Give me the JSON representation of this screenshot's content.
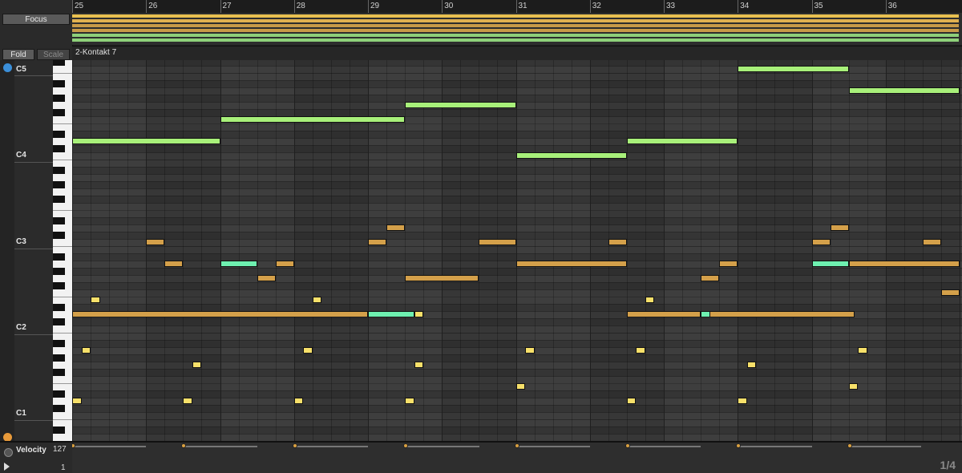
{
  "header": {
    "focus_label": "Focus",
    "fold_label": "Fold",
    "scale_label": "Scale",
    "clip_name": "2-Kontakt 7"
  },
  "ruler": {
    "bars": [
      "25",
      "26",
      "27",
      "28",
      "29",
      "30",
      "31",
      "32",
      "33",
      "34",
      "35",
      "36"
    ]
  },
  "piano": {
    "octave_labels": [
      "C5",
      "C4",
      "C3",
      "C2",
      "C1"
    ]
  },
  "velocity": {
    "label": "Velocity",
    "max_label": "127",
    "min_label": "1"
  },
  "footer": {
    "page_indicator": "1/4"
  },
  "colors": {
    "lead_note": "#a8f07a",
    "mid_note": "#d4a04a",
    "low_note": "#f7e06a",
    "highlight_note": "#6ef0b0",
    "accent_blue": "#3b8fd9",
    "accent_orange": "#e89a3a"
  },
  "icons": {
    "top_round": "arrow-up-circle-icon",
    "bottom_round": "arrow-down-circle-icon",
    "velocity_small": "velocity-toggle-icon",
    "velocity_play": "play-icon"
  }
}
